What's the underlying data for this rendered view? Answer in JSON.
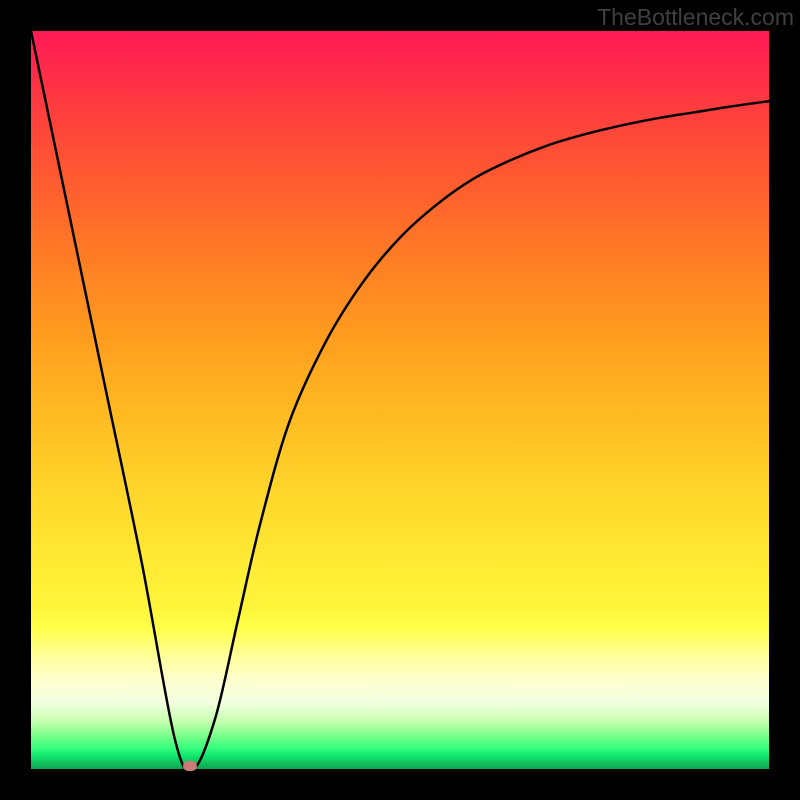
{
  "watermark_text": "TheBottleneck.com",
  "chart_data": {
    "type": "line",
    "title": "",
    "xlabel": "",
    "ylabel": "",
    "xlim": [
      0,
      100
    ],
    "ylim": [
      0,
      100
    ],
    "series": [
      {
        "name": "bottleneck-curve",
        "x": [
          0,
          5,
          10,
          15,
          19.5,
          22,
          25,
          28,
          31,
          35,
          40,
          45,
          50,
          55,
          60,
          65,
          70,
          75,
          80,
          85,
          90,
          95,
          100
        ],
        "values": [
          100,
          76,
          52,
          28,
          4,
          0,
          7,
          20,
          33,
          47,
          58,
          66,
          72,
          76.5,
          80,
          82.5,
          84.5,
          86,
          87.2,
          88.2,
          89,
          89.8,
          90.5
        ]
      }
    ],
    "annotations": [
      {
        "type": "marker",
        "x": 21.5,
        "y": 0,
        "label": "optimal-point"
      }
    ]
  },
  "colors": {
    "curve": "#000000",
    "marker": "#cc7a78",
    "frame": "#000000"
  }
}
